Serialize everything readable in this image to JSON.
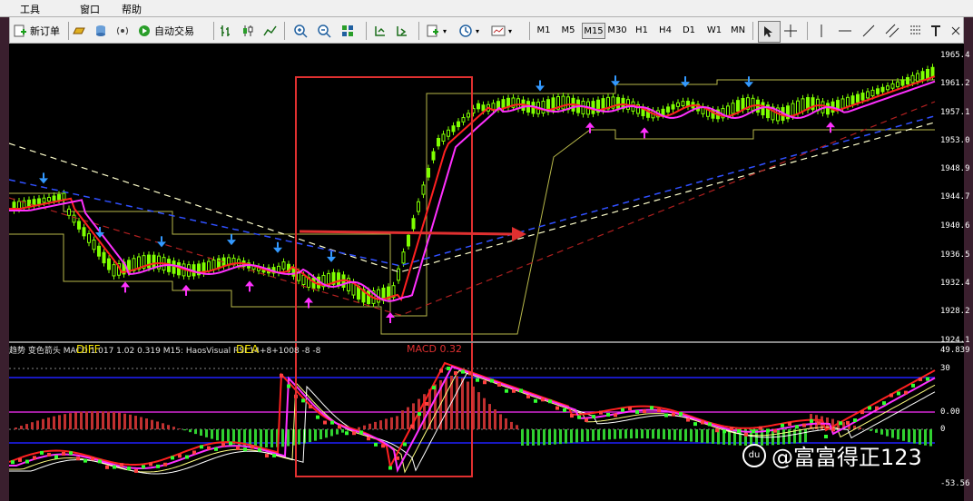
{
  "menu": {
    "items": [
      "工具",
      "窗口",
      "帮助"
    ]
  },
  "toolbar": {
    "new_order_label": "新订单",
    "auto_trade_label": "自动交易",
    "timeframes": [
      "M1",
      "M5",
      "M15",
      "M30",
      "H1",
      "H4",
      "D1",
      "W1",
      "MN"
    ],
    "active_timeframe": "M15"
  },
  "price_axis": {
    "labels": [
      "1965.4",
      "1961.2",
      "1957.1",
      "1953.0",
      "1948.9",
      "1944.7",
      "1940.6",
      "1936.5",
      "1932.4",
      "1928.2",
      "1924.1"
    ]
  },
  "indicator_axis": {
    "labels": [
      "49.839",
      "30",
      "0.00",
      "0",
      "-53.56"
    ]
  },
  "indicator_header": {
    "text": "趋势 变色箭头 MACD 1.017 1.02 0.319  M15: HaosVisual RSI 14+8+1008 -8 -8",
    "diff_label": "DIFF",
    "dea_label": "DEA",
    "macd_label": "MACD",
    "macd_value": "0.32"
  },
  "watermark": {
    "text": "@富富得正123",
    "logo_text": "du"
  },
  "colors": {
    "chart_bg": "#000000",
    "candle": "#7fff00",
    "ma_red": "#ff2020",
    "ma_magenta": "#ff30ff",
    "envelope": "#b8b84a",
    "highlight_box": "#e03030",
    "arrow_up": "#ff30ff",
    "arrow_down": "#3399ff"
  }
}
